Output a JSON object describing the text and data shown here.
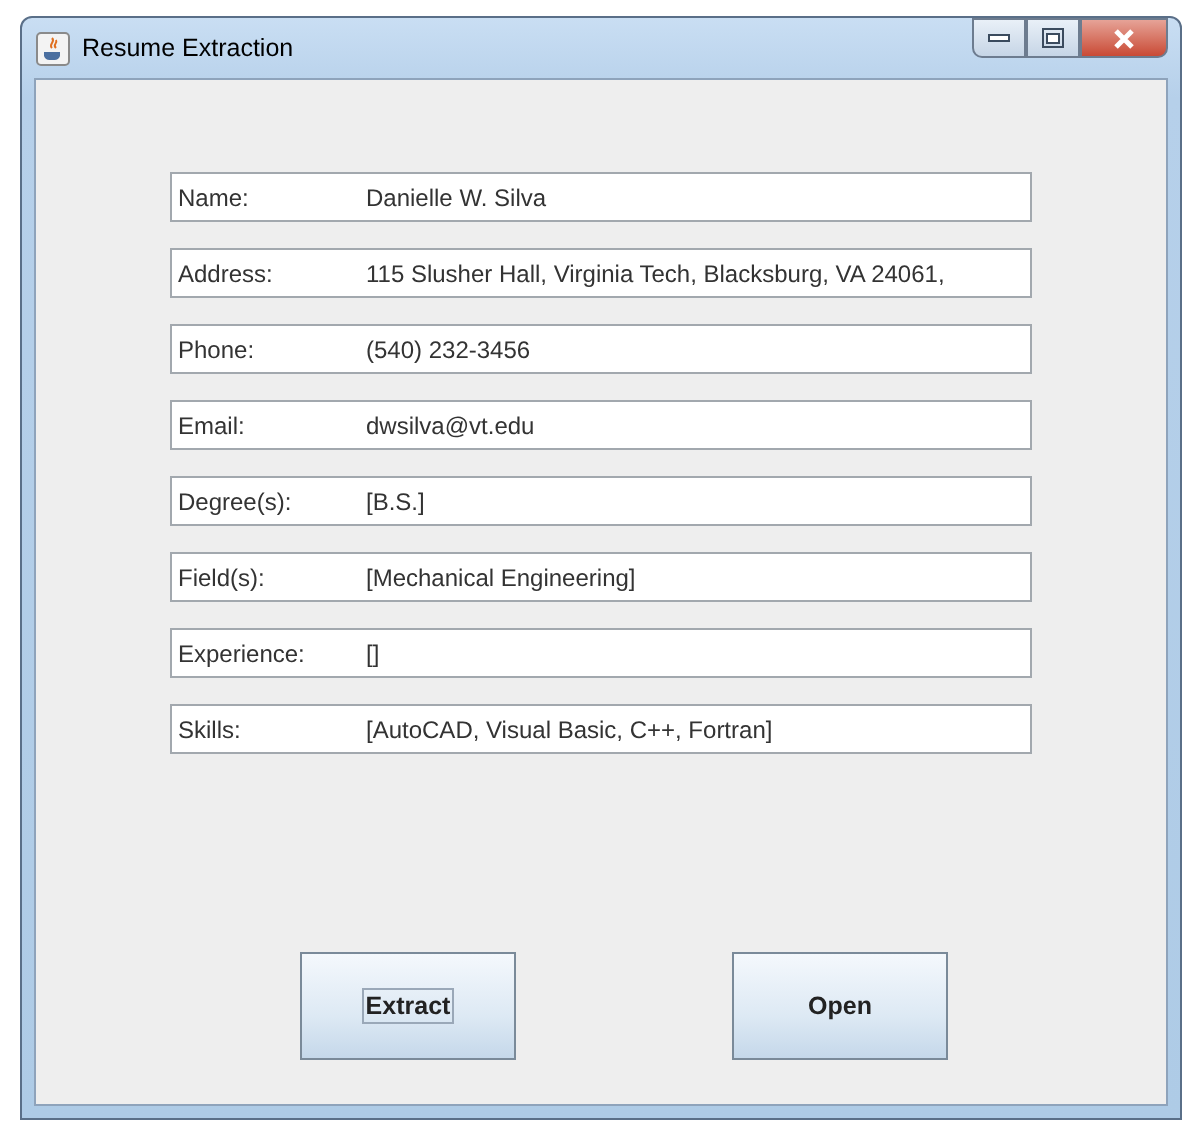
{
  "window": {
    "title": "Resume Extraction"
  },
  "fields": [
    {
      "label": "Name:",
      "value": "Danielle W. Silva"
    },
    {
      "label": "Address:",
      "value": "115 Slusher Hall, Virginia Tech, Blacksburg, VA 24061,"
    },
    {
      "label": "Phone:",
      "value": "(540) 232-3456"
    },
    {
      "label": "Email:",
      "value": "dwsilva@vt.edu"
    },
    {
      "label": "Degree(s):",
      "value": "[B.S.]"
    },
    {
      "label": "Field(s):",
      "value": "[Mechanical Engineering]"
    },
    {
      "label": "Experience:",
      "value": "[]"
    },
    {
      "label": "Skills:",
      "value": "[AutoCAD, Visual Basic, C++, Fortran]"
    }
  ],
  "buttons": [
    {
      "label": "Extract",
      "focused": true
    },
    {
      "label": "Open",
      "focused": false
    }
  ]
}
